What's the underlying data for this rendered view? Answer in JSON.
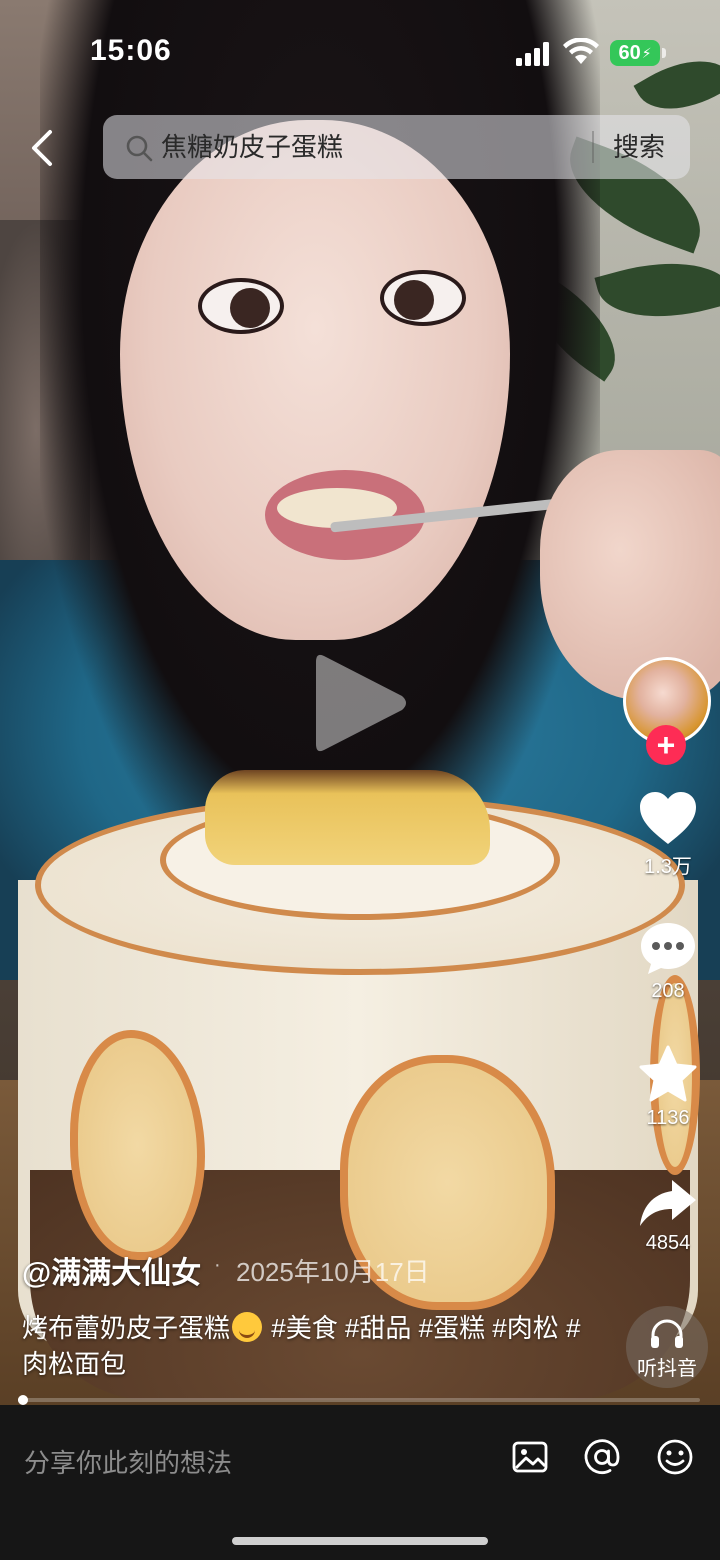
{
  "status_bar": {
    "time": "15:06",
    "battery": "60"
  },
  "search": {
    "query": "焦糖奶皮子蛋糕",
    "button_label": "搜索"
  },
  "actions": {
    "likes": "1.3万",
    "comments": "208",
    "favorites": "1136",
    "shares": "4854",
    "listen_label": "听抖音"
  },
  "post": {
    "author": "@满满大仙女",
    "separator": "·",
    "date": "2025年10月17日",
    "caption_before_emoji": "烤布蕾奶皮子蛋糕",
    "caption_after_emoji": " #美食 #甜品 #蛋糕 #肉松 #肉松面包",
    "emoji": "yum-face-emoji"
  },
  "playback": {
    "progress": 0.01
  },
  "comment_bar": {
    "placeholder": "分享你此刻的想法"
  },
  "colors": {
    "accent": "#fe2c55",
    "battery": "#34c759",
    "bottom_bar": "#161616"
  }
}
